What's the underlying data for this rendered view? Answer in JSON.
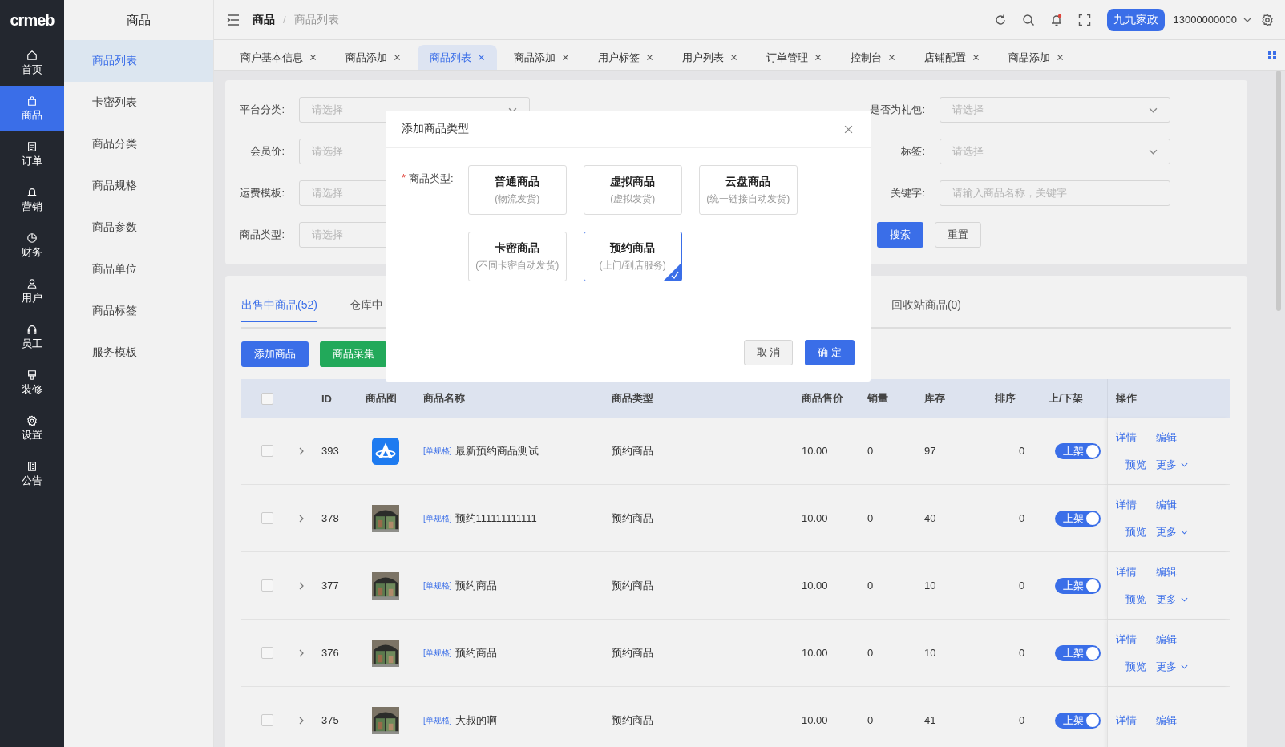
{
  "logo": "crmeb",
  "nav": [
    {
      "label": "首页",
      "selected": false
    },
    {
      "label": "商品",
      "selected": true
    },
    {
      "label": "订单",
      "selected": false
    },
    {
      "label": "营销",
      "selected": false
    },
    {
      "label": "财务",
      "selected": false
    },
    {
      "label": "用户",
      "selected": false
    },
    {
      "label": "员工",
      "selected": false
    },
    {
      "label": "装修",
      "selected": false
    },
    {
      "label": "设置",
      "selected": false
    },
    {
      "label": "公告",
      "selected": false
    }
  ],
  "submenu": {
    "title": "商品",
    "items": [
      {
        "label": "商品列表",
        "selected": true
      },
      {
        "label": "卡密列表",
        "selected": false
      },
      {
        "label": "商品分类",
        "selected": false
      },
      {
        "label": "商品规格",
        "selected": false
      },
      {
        "label": "商品参数",
        "selected": false
      },
      {
        "label": "商品单位",
        "selected": false
      },
      {
        "label": "商品标签",
        "selected": false
      },
      {
        "label": "服务模板",
        "selected": false
      }
    ]
  },
  "breadcrumb": {
    "items": [
      "商品",
      "商品列表"
    ],
    "separator": "/"
  },
  "header": {
    "shop_button": "九九家政",
    "account": "13000000000",
    "notification_dot": true
  },
  "tabs": [
    {
      "label": "商户基本信息",
      "selected": false
    },
    {
      "label": "商品添加",
      "selected": false
    },
    {
      "label": "商品列表",
      "selected": true
    },
    {
      "label": "商品添加",
      "selected": false
    },
    {
      "label": "用户标签",
      "selected": false
    },
    {
      "label": "用户列表",
      "selected": false
    },
    {
      "label": "订单管理",
      "selected": false
    },
    {
      "label": "控制台",
      "selected": false
    },
    {
      "label": "店铺配置",
      "selected": false
    },
    {
      "label": "商品添加",
      "selected": false
    }
  ],
  "filters_left": [
    {
      "label": "平台分类:",
      "placeholder": "请选择",
      "caret": true
    },
    {
      "label": "会员价:",
      "placeholder": "请选择"
    },
    {
      "label": "运费模板:",
      "placeholder": "请选择"
    },
    {
      "label": "商品类型:",
      "placeholder": "请选择"
    }
  ],
  "filters_right": [
    {
      "label": "是否为礼包:",
      "placeholder": "请选择",
      "caret": true
    },
    {
      "label": "标签:",
      "placeholder": "请选择",
      "caret": true
    },
    {
      "label": "关键字:",
      "placeholder": "请输入商品名称，关键字",
      "caret": false
    }
  ],
  "search_buttons": [
    "搜索",
    "重置"
  ],
  "list_tabs": [
    {
      "label": "出售中商品(52)",
      "selected": true
    },
    {
      "label": "仓库中",
      "selected": false
    },
    {
      "label": "回收站商品(0)",
      "selected": false
    }
  ],
  "list_buttons": [
    "添加商品",
    "商品采集"
  ],
  "table": {
    "header_checked": false,
    "columns": [
      "ID",
      "商品图",
      "商品名称",
      "商品类型",
      "商品售价",
      "销量",
      "库存",
      "排序",
      "上/下架",
      "操作"
    ],
    "rows": [
      {
        "id": "393",
        "kind": "icon",
        "tag": "[单规格]",
        "name": "最新预约商品测试",
        "type": "预约商品",
        "price": "10.00",
        "sales": "0",
        "stock": "97",
        "sort": "0",
        "status": "上架",
        "on": true,
        "checked": false,
        "actions": [
          "详情",
          "编辑",
          "预览",
          "更多"
        ]
      },
      {
        "id": "378",
        "kind": "picture",
        "tag": "[单规格]",
        "name": "预约111111111111",
        "type": "预约商品",
        "price": "10.00",
        "sales": "0",
        "stock": "40",
        "sort": "0",
        "status": "上架",
        "on": true,
        "checked": false,
        "actions": [
          "详情",
          "编辑",
          "预览",
          "更多"
        ]
      },
      {
        "id": "377",
        "kind": "picture",
        "tag": "[单规格]",
        "name": "预约商品",
        "type": "预约商品",
        "price": "10.00",
        "sales": "0",
        "stock": "10",
        "sort": "0",
        "status": "上架",
        "on": true,
        "checked": false,
        "actions": [
          "详情",
          "编辑",
          "预览",
          "更多"
        ]
      },
      {
        "id": "376",
        "kind": "picture",
        "tag": "[单规格]",
        "name": "预约商品",
        "type": "预约商品",
        "price": "10.00",
        "sales": "0",
        "stock": "10",
        "sort": "0",
        "status": "上架",
        "on": true,
        "checked": false,
        "actions": [
          "详情",
          "编辑",
          "预览",
          "更多"
        ]
      },
      {
        "id": "375",
        "kind": "picture",
        "tag": "[单规格]",
        "name": "大叔的啊",
        "type": "预约商品",
        "price": "10.00",
        "sales": "0",
        "stock": "41",
        "sort": "0",
        "status": "上架",
        "on": true,
        "checked": false,
        "actions": [
          "详情",
          "编辑"
        ]
      }
    ]
  },
  "dialog": {
    "title": "添加商品类型",
    "label": "商品类型:",
    "required_mark": "*",
    "options": [
      {
        "name": "普通商品",
        "desc": "(物流发货)",
        "selected": false
      },
      {
        "name": "虚拟商品",
        "desc": "(虚拟发货)",
        "selected": false
      },
      {
        "name": "云盘商品",
        "desc": "(统一链接自动发货)",
        "selected": false
      },
      {
        "name": "卡密商品",
        "desc": "(不同卡密自动发货)",
        "selected": false
      },
      {
        "name": "预约商品",
        "desc": "(上门/到店服务)",
        "selected": true
      }
    ],
    "buttons": [
      {
        "label": "取 消",
        "kind": "secondary"
      },
      {
        "label": "确 定",
        "kind": "primary"
      }
    ]
  }
}
